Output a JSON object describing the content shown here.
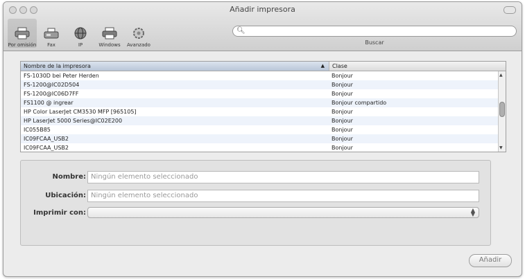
{
  "window": {
    "title": "Añadir impresora"
  },
  "toolbar": {
    "items": [
      {
        "label": "Por omisión",
        "icon": "default-printer-icon",
        "active": true
      },
      {
        "label": "Fax",
        "icon": "fax-icon",
        "active": false
      },
      {
        "label": "IP",
        "icon": "globe-icon",
        "active": false
      },
      {
        "label": "Windows",
        "icon": "windows-printer-icon",
        "active": false
      },
      {
        "label": "Avanzado",
        "icon": "gear-icon",
        "active": false
      }
    ]
  },
  "search": {
    "value": "",
    "placeholder": "",
    "label": "Buscar"
  },
  "list": {
    "columns": {
      "name": "Nombre de la impresora",
      "class": "Clase"
    },
    "rows": [
      {
        "name": "FS-1030D bei Peter Herden",
        "class": "Bonjour"
      },
      {
        "name": "FS-1200@IC02D504",
        "class": "Bonjour"
      },
      {
        "name": "FS-1200@IC06D7FF",
        "class": "Bonjour"
      },
      {
        "name": "FS1100 @ ingrear",
        "class": "Bonjour compartido"
      },
      {
        "name": "HP Color LaserJet CM3530 MFP [965105]",
        "class": "Bonjour"
      },
      {
        "name": "HP LaserJet 5000 Series@IC02E200",
        "class": "Bonjour"
      },
      {
        "name": "IC055B85",
        "class": "Bonjour"
      },
      {
        "name": "IC09FCAA_USB2",
        "class": "Bonjour"
      },
      {
        "name": "IC09FCAA_USB2",
        "class": "Bonjour"
      }
    ]
  },
  "details": {
    "name_label": "Nombre:",
    "name_value": "Ningún elemento seleccionado",
    "location_label": "Ubicación:",
    "location_value": "Ningún elemento seleccionado",
    "print_with_label": "Imprimir con:",
    "print_with_value": ""
  },
  "buttons": {
    "add": "Añadir"
  }
}
